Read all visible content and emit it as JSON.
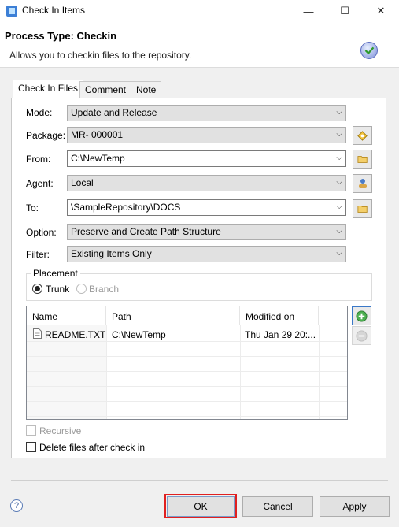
{
  "window": {
    "title": "Check In Items",
    "minimize_glyph": "—",
    "maximize_glyph": "☐",
    "close_glyph": "✕"
  },
  "header": {
    "title": "Process Type: Checkin",
    "description": "Allows you to checkin files to the repository."
  },
  "tabs": [
    {
      "label": "Check In Files",
      "active": true
    },
    {
      "label": "Comment",
      "active": false
    },
    {
      "label": "Note",
      "active": false
    }
  ],
  "form": {
    "mode": {
      "label": "Mode:",
      "value": "Update and Release"
    },
    "package": {
      "label": "Package:",
      "value": "MR- 000001"
    },
    "from": {
      "label": "From:",
      "value": "C:\\NewTemp"
    },
    "agent": {
      "label": "Agent:",
      "value": "Local"
    },
    "to": {
      "label": "To:",
      "value": "\\SampleRepository\\DOCS"
    },
    "option": {
      "label": "Option:",
      "value": "Preserve and Create Path Structure"
    },
    "filter": {
      "label": "Filter:",
      "value": "Existing Items Only"
    }
  },
  "placement": {
    "title": "Placement",
    "trunk_label": "Trunk",
    "branch_label": "Branch",
    "selected": "Trunk"
  },
  "table": {
    "columns": [
      "Name",
      "Path",
      "Modified on"
    ],
    "rows": [
      {
        "name": "README.TXT",
        "path": "C:\\NewTemp",
        "modified": "Thu Jan 29 20:..."
      }
    ]
  },
  "options": {
    "recursive_label": "Recursive",
    "recursive_checked": false,
    "delete_label": "Delete files after check in",
    "delete_checked": false
  },
  "footer": {
    "help_glyph": "?",
    "ok_label": "OK",
    "cancel_label": "Cancel",
    "apply_label": "Apply"
  },
  "colors": {
    "highlight": "#e02020",
    "add_icon": "#2e9a2e",
    "folder_icon": "#e8b54a"
  }
}
